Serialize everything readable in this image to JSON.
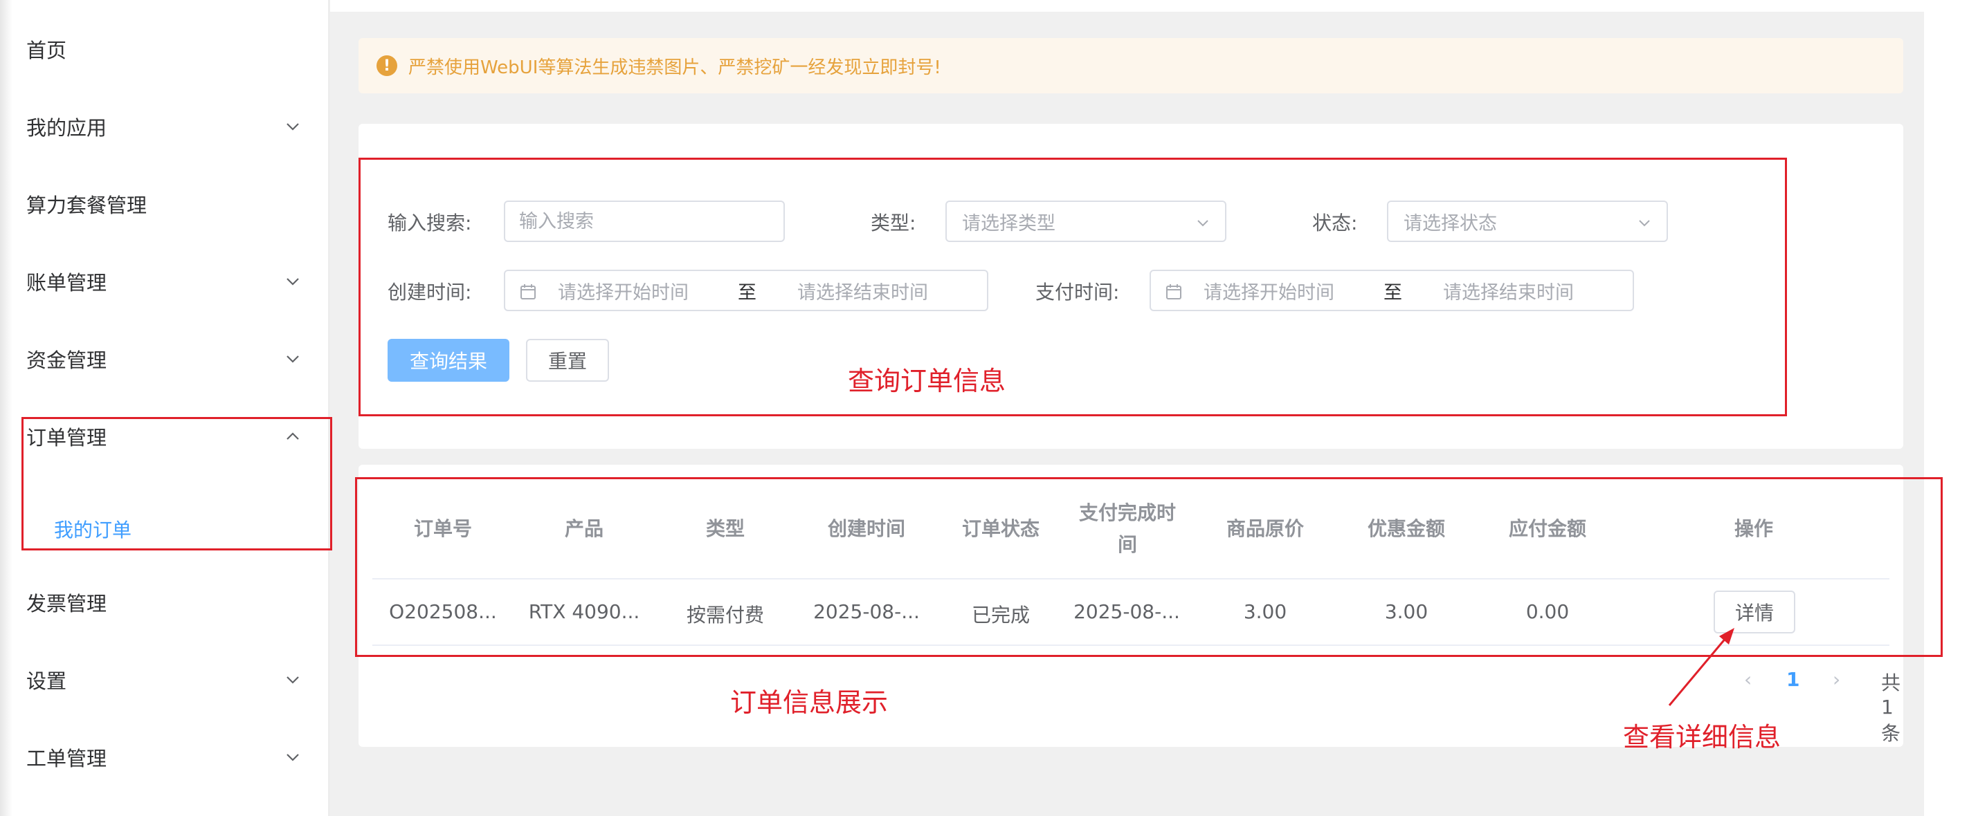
{
  "sidebar": {
    "items": [
      {
        "label": "首页"
      },
      {
        "label": "我的应用"
      },
      {
        "label": "算力套餐管理"
      },
      {
        "label": "账单管理"
      },
      {
        "label": "资金管理"
      },
      {
        "label": "订单管理"
      },
      {
        "label": "发票管理"
      },
      {
        "label": "设置"
      },
      {
        "label": "工单管理"
      }
    ],
    "sub_items": [
      {
        "label": "我的订单"
      }
    ]
  },
  "alert": {
    "text": "严禁使用WebUI等算法生成违禁图片、严禁挖矿一经发现立即封号!"
  },
  "search": {
    "keyword_label": "输入搜索:",
    "keyword_placeholder": "输入搜索",
    "type_label": "类型:",
    "type_placeholder": "请选择类型",
    "status_label": "状态:",
    "status_placeholder": "请选择状态",
    "created_label": "创建时间:",
    "paid_label": "支付时间:",
    "start_placeholder": "请选择开始时间",
    "range_sep": "至",
    "end_placeholder": "请选择结束时间",
    "query_button": "查询结果",
    "reset_button": "重置"
  },
  "table": {
    "headers": [
      "订单号",
      "产品",
      "类型",
      "创建时间",
      "订单状态",
      "支付完成时间",
      "商品原价",
      "优惠金额",
      "应付金额",
      "操作"
    ],
    "rows": [
      [
        "O202508...",
        "RTX 4090...",
        "按需付费",
        "2025-08-...",
        "已完成",
        "2025-08-...",
        "3.00",
        "3.00",
        "0.00",
        "详情"
      ]
    ]
  },
  "pagination": {
    "prev": "‹",
    "current": "1",
    "next": "›",
    "total": "共 1 条"
  },
  "annotations": {
    "query_note": "查询订单信息",
    "list_note": "订单信息展示",
    "detail_note": "查看详细信息"
  },
  "colors": {
    "accent": "#409eff",
    "primary_button": "#79bbff",
    "warning": "#e6a23c",
    "annotation": "#e0202a"
  }
}
